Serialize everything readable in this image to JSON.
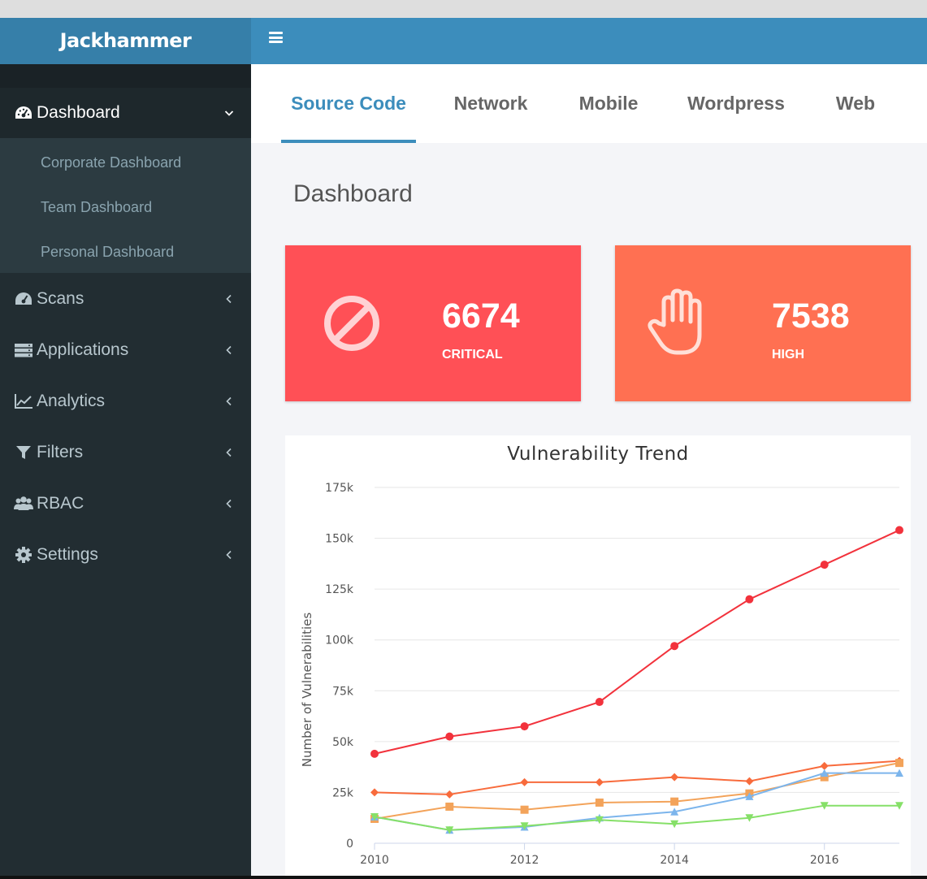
{
  "app": {
    "title": "Jackhammer"
  },
  "sidebar": {
    "items": [
      {
        "label": "Dashboard",
        "icon": "tachometer-icon",
        "expanded": true,
        "children": [
          {
            "label": "Corporate Dashboard"
          },
          {
            "label": "Team Dashboard"
          },
          {
            "label": "Personal Dashboard"
          }
        ]
      },
      {
        "label": "Scans",
        "icon": "tachometer-icon"
      },
      {
        "label": "Applications",
        "icon": "server-icon"
      },
      {
        "label": "Analytics",
        "icon": "line-chart-icon"
      },
      {
        "label": "Filters",
        "icon": "filter-icon"
      },
      {
        "label": "RBAC",
        "icon": "users-icon"
      },
      {
        "label": "Settings",
        "icon": "gear-icon"
      }
    ]
  },
  "tabs": [
    {
      "label": "Source Code",
      "active": true
    },
    {
      "label": "Network",
      "active": false
    },
    {
      "label": "Mobile",
      "active": false
    },
    {
      "label": "Wordpress",
      "active": false
    },
    {
      "label": "Web",
      "active": false
    }
  ],
  "main": {
    "title": "Dashboard",
    "stats": [
      {
        "value": "6674",
        "label": "CRITICAL",
        "color": "#ff5056",
        "icon": "ban-icon"
      },
      {
        "value": "7538",
        "label": "HIGH",
        "color": "#ff7052",
        "icon": "hand-stop-icon"
      }
    ]
  },
  "colors": {
    "brand": "#367fa9",
    "topbar": "#3c8dbc",
    "sidebar": "#222d32"
  },
  "chart_data": {
    "type": "line",
    "title": "Vulnerability Trend",
    "xlabel": "",
    "ylabel": "Number of Vulnerabilities",
    "x": [
      2010,
      2011,
      2012,
      2013,
      2014,
      2015,
      2016,
      2017
    ],
    "xticks": [
      "2010",
      "2012",
      "2014",
      "2016"
    ],
    "yticks": [
      "0",
      "25k",
      "50k",
      "75k",
      "100k",
      "125k",
      "150k",
      "175k"
    ],
    "xlim": [
      2010,
      2017
    ],
    "ylim": [
      0,
      175000
    ],
    "grid": true,
    "series": [
      {
        "color": "#f2323c",
        "marker": "circle",
        "values": [
          44000,
          52500,
          57500,
          69500,
          97000,
          120000,
          137000,
          154000
        ]
      },
      {
        "color": "#f86b3c",
        "marker": "diamond",
        "values": [
          25000,
          24000,
          30000,
          30000,
          32500,
          30500,
          38000,
          40500
        ]
      },
      {
        "color": "#f3a35a",
        "marker": "square",
        "values": [
          12000,
          18000,
          16500,
          20000,
          20500,
          24500,
          32500,
          39500
        ]
      },
      {
        "color": "#7cb5ec",
        "marker": "triangle",
        "values": [
          13000,
          6500,
          8000,
          12500,
          15500,
          23000,
          34500,
          34500
        ]
      },
      {
        "color": "#86e068",
        "marker": "triangle-down",
        "values": [
          13000,
          6500,
          8500,
          11500,
          9500,
          12500,
          18500,
          18500
        ]
      }
    ]
  }
}
